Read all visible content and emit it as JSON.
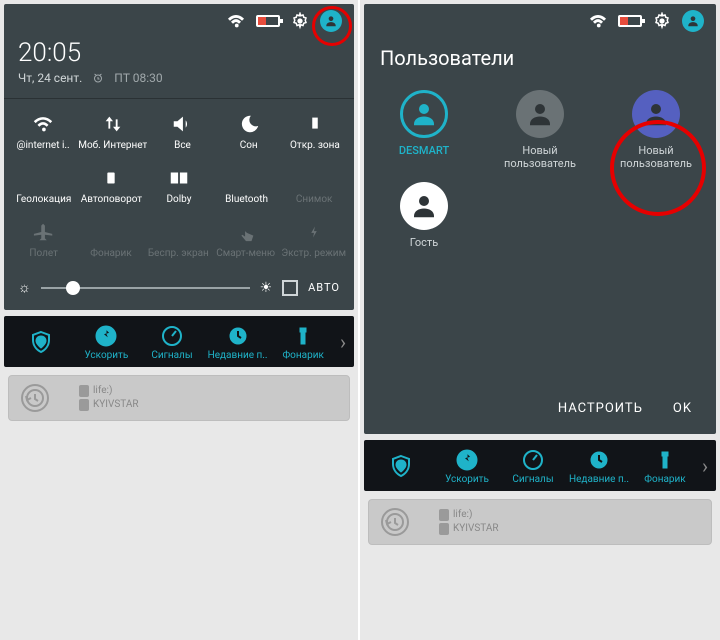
{
  "left": {
    "clock": "20:05",
    "date": "Чт, 24 сент.",
    "alarm": "ПТ 08:30",
    "tiles": [
      {
        "label": "@internet i..",
        "icon": "wifi",
        "dim": false
      },
      {
        "label": "Моб. Интернет",
        "icon": "updown",
        "dim": false
      },
      {
        "label": "Все",
        "icon": "volume",
        "dim": false
      },
      {
        "label": "Сон",
        "icon": "moon",
        "dim": false
      },
      {
        "label": "Откр. зона",
        "icon": "phone",
        "dim": false
      },
      {
        "label": "Геолокация",
        "icon": "nogeo",
        "dim": false
      },
      {
        "label": "Автоповорот",
        "icon": "rotate",
        "dim": false
      },
      {
        "label": "Dolby",
        "icon": "dolby",
        "dim": false
      },
      {
        "label": "Bluetooth",
        "icon": "bt",
        "dim": false
      },
      {
        "label": "Снимок",
        "icon": "crop",
        "dim": true
      },
      {
        "label": "Полет",
        "icon": "plane",
        "dim": true
      },
      {
        "label": "Фонарик",
        "icon": "torch",
        "dim": true
      },
      {
        "label": "Беспр. экран",
        "icon": "cast",
        "dim": true
      },
      {
        "label": "Смарт-меню",
        "icon": "touch",
        "dim": true
      },
      {
        "label": "Экстр. режим",
        "icon": "pwr",
        "dim": true
      }
    ],
    "auto_label": "АВТО",
    "toolstrip": [
      {
        "label": "Ускорить",
        "icon": "boost"
      },
      {
        "label": "Сигналы",
        "icon": "gauge"
      },
      {
        "label": "Недавние п..",
        "icon": "recent"
      },
      {
        "label": "Фонарик",
        "icon": "torch2"
      }
    ],
    "sim1": "life:)",
    "sim2": "KYIVSTAR"
  },
  "right": {
    "title": "Пользователи",
    "users": [
      {
        "name": "DESMART",
        "style": "on",
        "sel": true
      },
      {
        "name": "Новый пользователь",
        "style": "off"
      },
      {
        "name": "Новый пользователь",
        "style": "dk"
      },
      {
        "name": "Гость",
        "style": "wh"
      }
    ],
    "btn_setup": "НАСТРОИТЬ",
    "btn_ok": "OK",
    "toolstrip": [
      {
        "label": "Ускорить",
        "icon": "boost"
      },
      {
        "label": "Сигналы",
        "icon": "gauge"
      },
      {
        "label": "Недавние п..",
        "icon": "recent"
      },
      {
        "label": "Фонарик",
        "icon": "torch2"
      }
    ],
    "sim1": "life:)",
    "sim2": "KYIVSTAR"
  }
}
